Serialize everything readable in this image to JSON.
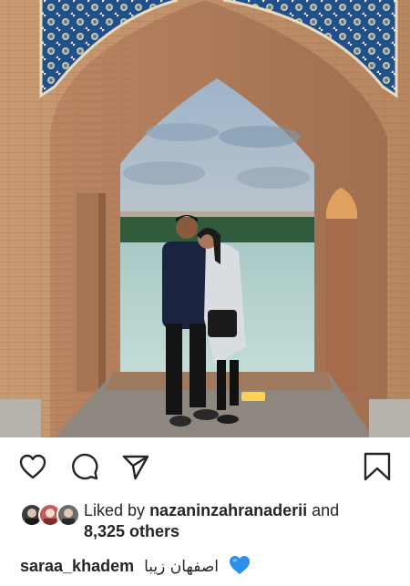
{
  "post": {
    "liked_by_prefix": "Liked by",
    "liked_by_user": "nazaninzahranaderii",
    "and_word": "and",
    "others_count": "8,325 others",
    "caption_user": "saraa_khadem",
    "caption_text": "اصفهان زیبا"
  },
  "icons": {
    "like": "heart-outline-icon",
    "comment": "comment-bubble-icon",
    "share": "paper-plane-icon",
    "save": "bookmark-icon",
    "caption_emoji": "blue-heart-emoji"
  },
  "colors": {
    "text": "#262626",
    "icon_stroke": "#262626",
    "emoji_blue": "#2d8fe8"
  }
}
